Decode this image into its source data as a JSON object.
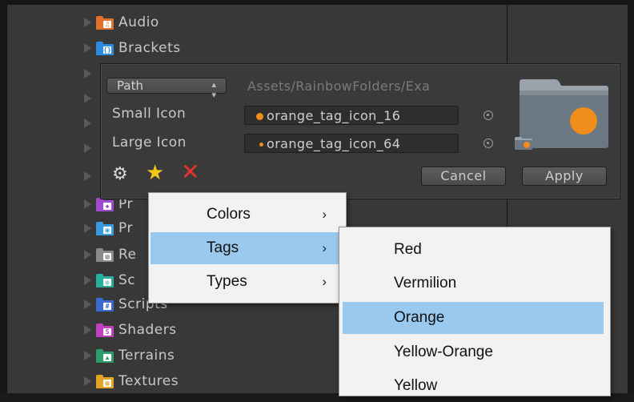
{
  "tree": {
    "items": [
      {
        "label": "Audio",
        "color": "#e0722a",
        "glyph": "♫"
      },
      {
        "label": "Brackets",
        "color": "#2a8be0",
        "glyph": "{}"
      },
      {
        "label": "Pr",
        "color": "#a04cd0",
        "glyph": "◆"
      },
      {
        "label": "Pr",
        "color": "#3a9ce0",
        "glyph": "▣"
      },
      {
        "label": "Re",
        "color": "#8a8a8a",
        "glyph": "▤"
      },
      {
        "label": "Sc",
        "color": "#27b0a0",
        "glyph": "◎"
      },
      {
        "label": "Scripts",
        "color": "#3a6bd0",
        "glyph": "#"
      },
      {
        "label": "Shaders",
        "color": "#c040c0",
        "glyph": "S"
      },
      {
        "label": "Terrains",
        "color": "#2f9a6a",
        "glyph": "▲"
      },
      {
        "label": "Textures",
        "color": "#e2a526",
        "glyph": "▦"
      }
    ]
  },
  "inspector": {
    "key_type": "Path",
    "key_value": "Assets/RainbowFolders/Exa",
    "small_icon_label": "Small Icon",
    "small_icon_value": "orange_tag_icon_16",
    "large_icon_label": "Large Icon",
    "large_icon_value": "orange_tag_icon_64",
    "cancel_label": "Cancel",
    "apply_label": "Apply",
    "accent_color": "#f08c1a"
  },
  "context_menu": {
    "items": [
      {
        "label": "Colors",
        "submenu": "›"
      },
      {
        "label": "Tags",
        "submenu": "›",
        "highlighted": true
      },
      {
        "label": "Types",
        "submenu": "›"
      }
    ]
  },
  "tags_menu": {
    "items": [
      {
        "label": "Red"
      },
      {
        "label": "Vermilion"
      },
      {
        "label": "Orange",
        "highlighted": true
      },
      {
        "label": "Yellow-Orange"
      },
      {
        "label": "Yellow"
      }
    ]
  },
  "colors": {
    "highlight": "#99c9ef",
    "menu_bg": "#f2f2f2"
  }
}
